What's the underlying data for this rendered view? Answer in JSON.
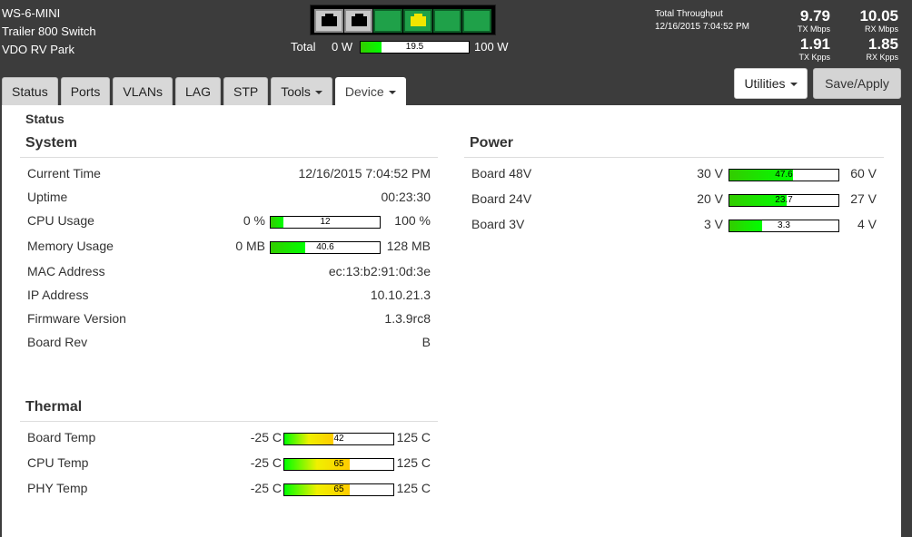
{
  "device": {
    "model": "WS-6-MINI",
    "name": "Trailer 800 Switch",
    "location": "VDO RV Park"
  },
  "ports": [
    {
      "status": "off"
    },
    {
      "status": "off"
    },
    {
      "status": "on"
    },
    {
      "status": "warn"
    },
    {
      "status": "on"
    },
    {
      "status": "on"
    }
  ],
  "power_total": {
    "label": "Total",
    "min_label": "0 W",
    "max_label": "100 W",
    "value": "19.5",
    "fraction": 0.195
  },
  "throughput": {
    "title": "Total Throughput",
    "timestamp": "12/16/2015 7:04:52 PM",
    "tx_mbps": "9.79",
    "tx_mbps_label": "TX Mbps",
    "rx_mbps": "10.05",
    "rx_mbps_label": "RX Mbps",
    "tx_kpps": "1.91",
    "tx_kpps_label": "TX Kpps",
    "rx_kpps": "1.85",
    "rx_kpps_label": "RX Kpps"
  },
  "tabs": [
    {
      "label": "Status",
      "active": false,
      "dropdown": false
    },
    {
      "label": "Ports",
      "active": false,
      "dropdown": false
    },
    {
      "label": "VLANs",
      "active": false,
      "dropdown": false
    },
    {
      "label": "LAG",
      "active": false,
      "dropdown": false
    },
    {
      "label": "STP",
      "active": false,
      "dropdown": false
    },
    {
      "label": "Tools",
      "active": false,
      "dropdown": true
    },
    {
      "label": "Device",
      "active": true,
      "dropdown": true
    }
  ],
  "buttons": {
    "utilities": "Utilities",
    "save_apply": "Save/Apply"
  },
  "page_title": "Status",
  "system": {
    "title": "System",
    "current_time_label": "Current Time",
    "current_time": "12/16/2015 7:04:52 PM",
    "uptime_label": "Uptime",
    "uptime": "00:23:30",
    "cpu": {
      "label": "CPU Usage",
      "min": "0 %",
      "max": "100 %",
      "value": "12",
      "fraction": 0.12
    },
    "memory": {
      "label": "Memory Usage",
      "min": "0 MB",
      "max": "128 MB",
      "value": "40.6",
      "fraction": 0.317
    },
    "mac_label": "MAC Address",
    "mac": "ec:13:b2:91:0d:3e",
    "ip_label": "IP Address",
    "ip": "10.10.21.3",
    "firmware_label": "Firmware Version",
    "firmware": "1.3.9rc8",
    "board_rev_label": "Board Rev",
    "board_rev": "B"
  },
  "power": {
    "title": "Power",
    "rails": [
      {
        "label": "Board 48V",
        "min": "30 V",
        "max": "60 V",
        "value": "47.6",
        "fraction": 0.587
      },
      {
        "label": "Board 24V",
        "min": "20 V",
        "max": "27 V",
        "value": "23.7",
        "fraction": 0.529
      },
      {
        "label": "Board 3V",
        "min": "3 V",
        "max": "4 V",
        "value": "3.3",
        "fraction": 0.3
      }
    ]
  },
  "thermal": {
    "title": "Thermal",
    "sensors": [
      {
        "label": "Board Temp",
        "min": "-25 C",
        "max": "125 C",
        "value": "42",
        "fraction": 0.447
      },
      {
        "label": "CPU Temp",
        "min": "-25 C",
        "max": "125 C",
        "value": "65",
        "fraction": 0.6
      },
      {
        "label": "PHY Temp",
        "min": "-25 C",
        "max": "125 C",
        "value": "65",
        "fraction": 0.6
      }
    ]
  },
  "colors": {
    "header_bg": "#3c3c3c",
    "port_on": "#1fa149",
    "port_warn": "#f2e600",
    "bar_green": "#00ff00",
    "bar_yellow": "#ffcc00"
  }
}
